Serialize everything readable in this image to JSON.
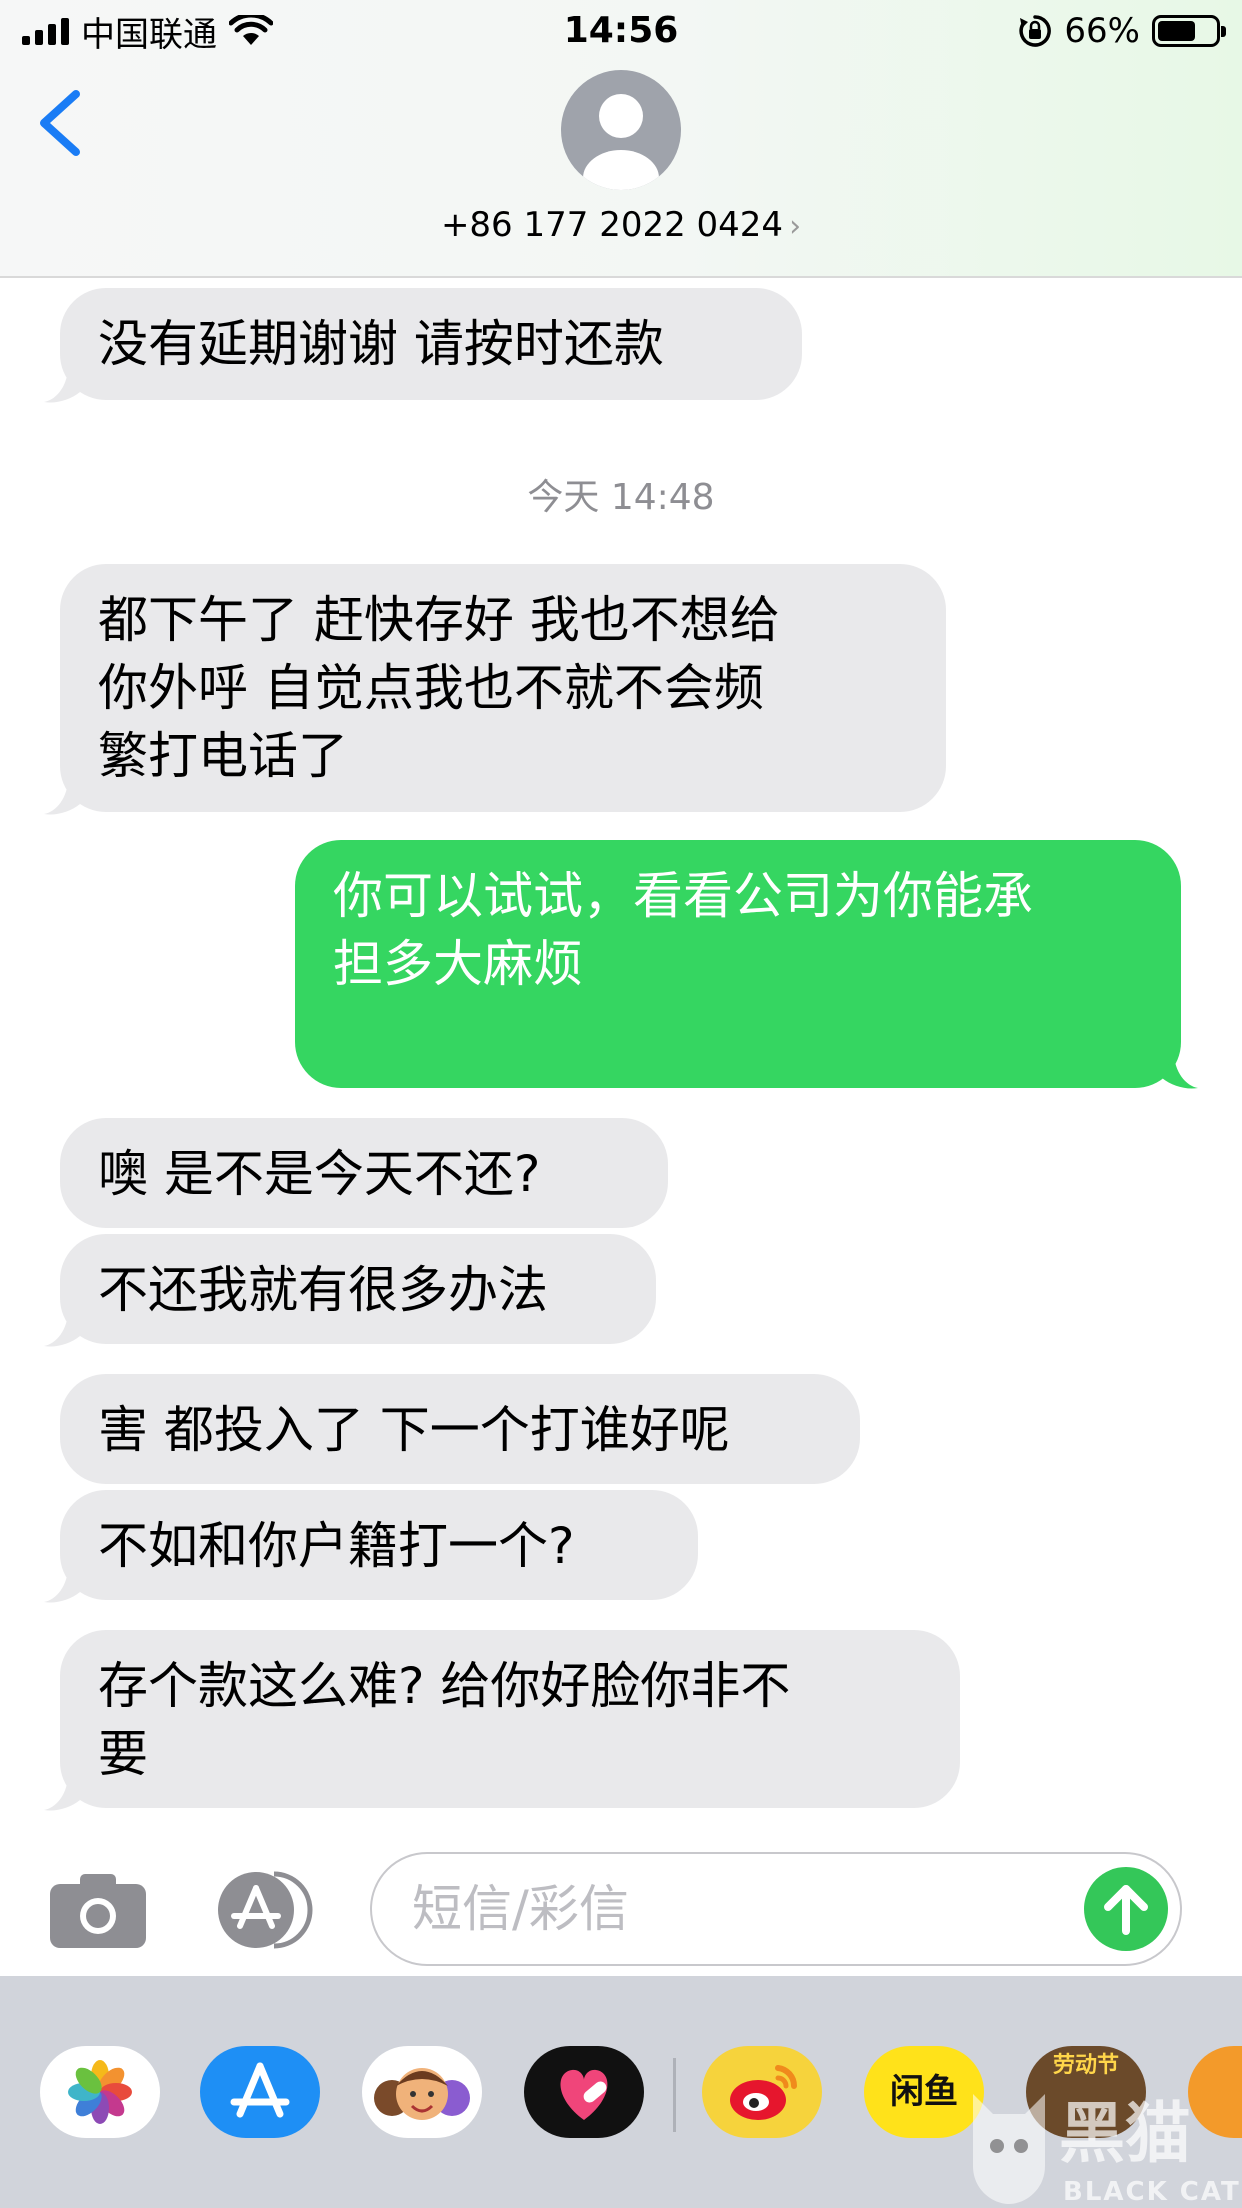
{
  "status_bar": {
    "carrier": "中国联通",
    "time": "14:56",
    "battery_percent": "66%",
    "battery_level": 0.66
  },
  "header": {
    "contact_number": "+86 177 2022 0424",
    "chevron": "›"
  },
  "conversation": {
    "timestamp": "今天 14:48",
    "messages": [
      {
        "direction": "incoming",
        "text": "没有延期谢谢  请按时还款"
      },
      {
        "direction": "incoming",
        "lines": [
          "都下午了  赶快存好  我也不想给",
          "你外呼  自觉点我也不就不会频",
          "繁打电话了"
        ]
      },
      {
        "direction": "outgoing",
        "lines": [
          "你可以试试，看看公司为你能承",
          "担多大麻烦"
        ]
      },
      {
        "direction": "incoming",
        "text": "噢  是不是今天不还?"
      },
      {
        "direction": "incoming",
        "text": "不还我就有很多办法"
      },
      {
        "direction": "incoming",
        "text": "害 都投入了 下一个打谁好呢"
      },
      {
        "direction": "incoming",
        "text": "不如和你户籍打一个?"
      },
      {
        "direction": "incoming",
        "lines": [
          "存个款这么难?  给你好脸你非不",
          "要"
        ]
      }
    ]
  },
  "input_bar": {
    "placeholder": "短信/彩信"
  },
  "app_drawer": {
    "apps": [
      "photos-app",
      "app-store-app",
      "memoji-app",
      "digital-touch-app",
      "weibo-app",
      "xianyu-app",
      "game-app",
      "partial-app"
    ],
    "xianyu_label": "闲鱼",
    "game_label": "劳动节"
  },
  "watermark": {
    "text": "黑猫",
    "subtext": "BLACK CAT"
  },
  "colors": {
    "incoming_bubble": "#e9e9eb",
    "outgoing_bubble": "#35d661",
    "accent_blue": "#1a7cf5",
    "send_green": "#34c759"
  }
}
